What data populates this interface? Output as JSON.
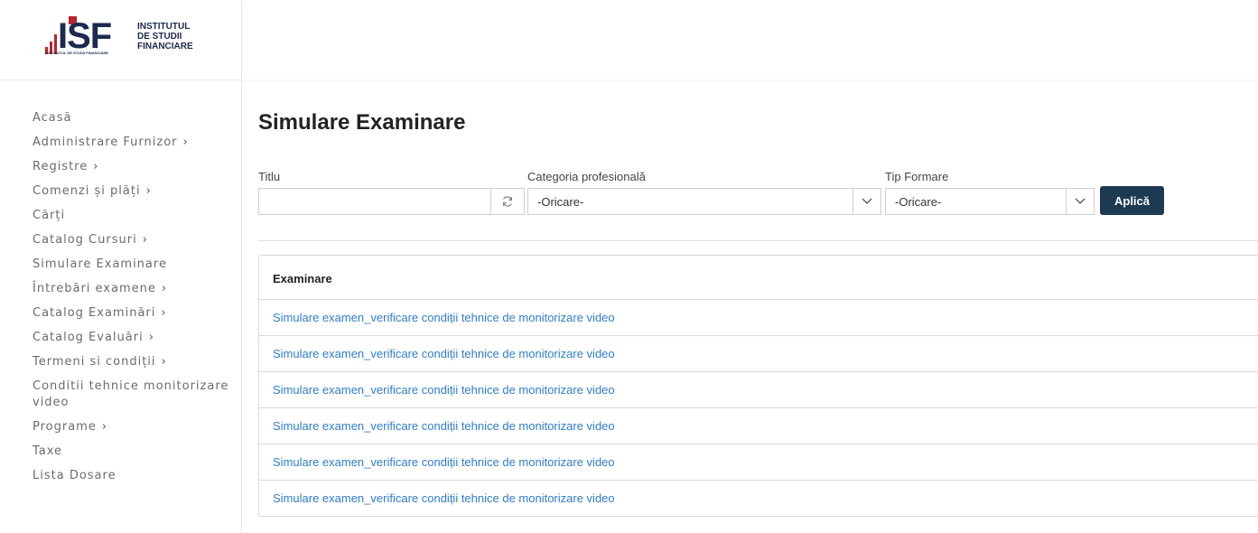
{
  "brand": {
    "logo_letters": "ISF",
    "logo_line1": "INSTITUTUL",
    "logo_line2": "DE STUDII",
    "logo_line3": "FINANCIARE",
    "logo_small": "INSTITUTUL DE STUDII FINANCIARE",
    "accent_color": "#b9252c",
    "navy_color": "#1b2a4e"
  },
  "sidebar": {
    "items": [
      {
        "label": "Acasă",
        "has_submenu": false
      },
      {
        "label": "Administrare Furnizor",
        "has_submenu": true
      },
      {
        "label": "Registre",
        "has_submenu": true
      },
      {
        "label": "Comenzi și plăți",
        "has_submenu": true
      },
      {
        "label": "Cărți",
        "has_submenu": false
      },
      {
        "label": "Catalog Cursuri",
        "has_submenu": true
      },
      {
        "label": "Simulare Examinare",
        "has_submenu": false
      },
      {
        "label": "Întrebări examene",
        "has_submenu": true
      },
      {
        "label": "Catalog Examinări",
        "has_submenu": true
      },
      {
        "label": "Catalog Evaluări",
        "has_submenu": true
      },
      {
        "label": "Termeni si condiții",
        "has_submenu": true
      },
      {
        "label": "Conditii tehnice monitorizare video",
        "has_submenu": false
      },
      {
        "label": "Programe",
        "has_submenu": true
      },
      {
        "label": "Taxe",
        "has_submenu": false
      },
      {
        "label": "Lista Dosare",
        "has_submenu": false
      }
    ],
    "submenu_glyph": "›"
  },
  "main": {
    "title": "Simulare Examinare",
    "filters": {
      "title_label": "Titlu",
      "title_value": "",
      "category_label": "Categoria profesională",
      "category_value": "-Oricare-",
      "training_label": "Tip Formare",
      "training_value": "-Oricare-",
      "apply_label": "Aplică"
    },
    "table": {
      "header": "Examinare",
      "rows": [
        "Simulare examen_verificare condiții tehnice de monitorizare video",
        "Simulare examen_verificare condiții tehnice de monitorizare video",
        "Simulare examen_verificare condiții tehnice de monitorizare video",
        "Simulare examen_verificare condiții tehnice de monitorizare video",
        "Simulare examen_verificare condiții tehnice de monitorizare video",
        "Simulare examen_verificare condiții tehnice de monitorizare video"
      ]
    },
    "button_color": "#1e3a52",
    "link_color": "#2f7dd0"
  }
}
